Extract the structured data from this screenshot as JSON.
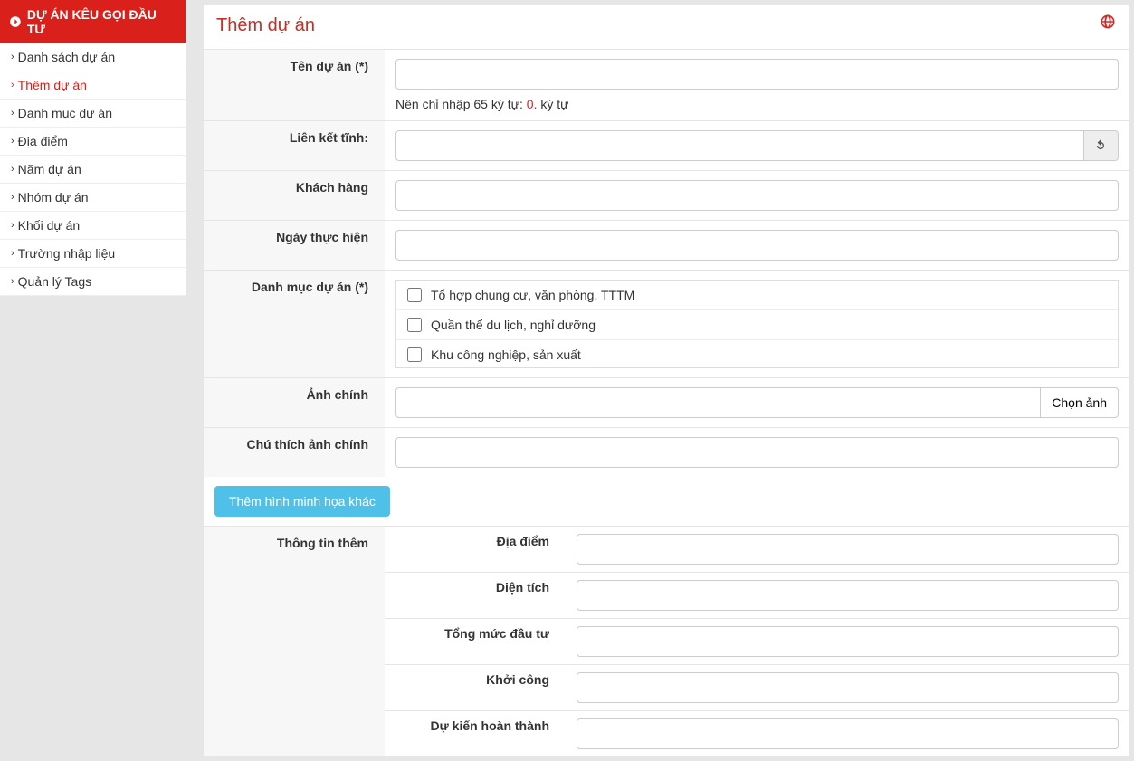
{
  "sidebar": {
    "header": "DỰ ÁN KÊU GỌI ĐẦU TƯ",
    "items": [
      {
        "label": "Danh sách dự án",
        "active": false
      },
      {
        "label": "Thêm dự án",
        "active": true
      },
      {
        "label": "Danh mục dự án",
        "active": false
      },
      {
        "label": "Địa điểm",
        "active": false
      },
      {
        "label": "Năm dự án",
        "active": false
      },
      {
        "label": "Nhóm dự án",
        "active": false
      },
      {
        "label": "Khối dự án",
        "active": false
      },
      {
        "label": "Trường nhập liệu",
        "active": false
      },
      {
        "label": "Quản lý Tags",
        "active": false
      }
    ]
  },
  "page": {
    "title": "Thêm dự án"
  },
  "form": {
    "project_name_label": "Tên dự án (*)",
    "project_name_help_prefix": "Nên chỉ nhập 65 ký tự:",
    "project_name_help_count": "0.",
    "project_name_help_suffix": "ký tự",
    "static_link_label": "Liên kết tĩnh:",
    "customer_label": "Khách hàng",
    "date_label": "Ngày thực hiện",
    "category_label": "Danh mục dự án (*)",
    "categories": [
      "Tổ hợp chung cư, văn phòng, TTTM",
      "Quần thể du lịch, nghỉ dưỡng",
      "Khu công nghiệp, sản xuất"
    ],
    "main_image_label": "Ảnh chính",
    "choose_image_btn": "Chọn ảnh",
    "main_image_caption_label": "Chú thích ảnh chính",
    "add_more_images_btn": "Thêm hình minh họa khác",
    "extra_info_label": "Thông tin thêm",
    "extra_fields": {
      "location": "Địa điểm",
      "area": "Diện tích",
      "total_investment": "Tổng mức đầu tư",
      "start": "Khởi công",
      "expected_completion": "Dự kiến hoàn thành"
    }
  }
}
